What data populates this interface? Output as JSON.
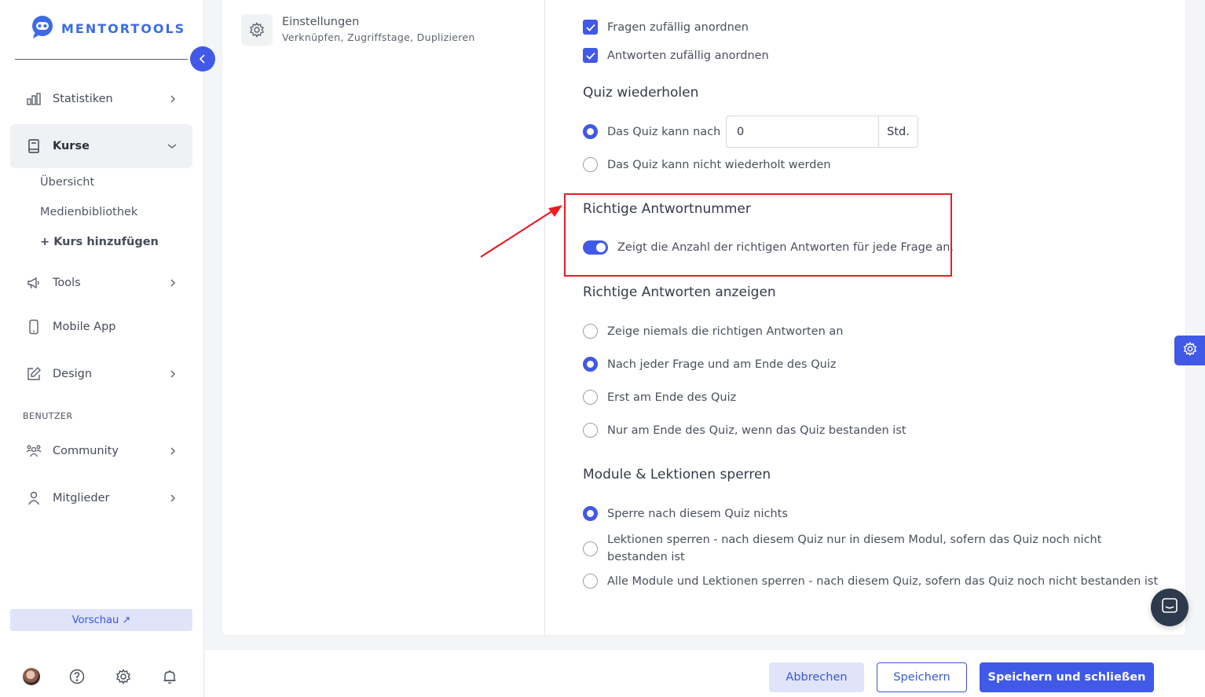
{
  "brand": {
    "name": "MENTORTOOLS",
    "accent": "#4059e6",
    "highlight": "#ea1c24"
  },
  "sidebar": {
    "items": [
      {
        "label": "Statistiken",
        "icon": "bar-chart-icon"
      },
      {
        "label": "Kurse",
        "icon": "book-icon"
      },
      {
        "label": "Tools",
        "icon": "megaphone-icon"
      },
      {
        "label": "Mobile App",
        "icon": "mobile-icon"
      },
      {
        "label": "Design",
        "icon": "edit-icon"
      },
      {
        "label": "Community",
        "icon": "community-icon"
      },
      {
        "label": "Mitglieder",
        "icon": "user-icon"
      }
    ],
    "sub_items": [
      "Übersicht",
      "Medienbibliothek",
      "+ Kurs hinzufügen"
    ],
    "section_label": "BENUTZER",
    "preview_label": "Vorschau ↗"
  },
  "left_panel": {
    "title": "Einstellungen",
    "subtitle": "Verknüpfen, Zugriffstage, Duplizieren"
  },
  "settings": {
    "random": {
      "options": [
        "Fragen zufällig anordnen",
        "Antworten zufällig anordnen"
      ]
    },
    "repeat": {
      "heading": "Quiz wiederholen",
      "option_after": "Das Quiz kann nach",
      "hours_value": "0",
      "hours_unit": "Std.",
      "option_never": "Das Quiz kann nicht wiederholt werden"
    },
    "correct_count": {
      "heading": "Richtige Antwortnummer",
      "toggle_label": "Zeigt die Anzahl der richtigen Antworten für jede Frage an."
    },
    "show_answers": {
      "heading": "Richtige Antworten anzeigen",
      "options": [
        "Zeige niemals die richtigen Antworten an",
        "Nach jeder Frage und am Ende des Quiz",
        "Erst am Ende des Quiz",
        "Nur am Ende des Quiz, wenn das Quiz bestanden ist"
      ]
    },
    "lock": {
      "heading": "Module & Lektionen sperren",
      "options": [
        "Sperre nach diesem Quiz nichts",
        "Lektionen sperren - nach diesem Quiz nur in diesem Modul, sofern das Quiz noch nicht bestanden ist",
        "Alle Module und Lektionen sperren - nach diesem Quiz, sofern das Quiz noch nicht bestanden ist"
      ]
    }
  },
  "footer": {
    "cancel": "Abbrechen",
    "save": "Speichern",
    "save_close": "Speichern und schließen"
  }
}
